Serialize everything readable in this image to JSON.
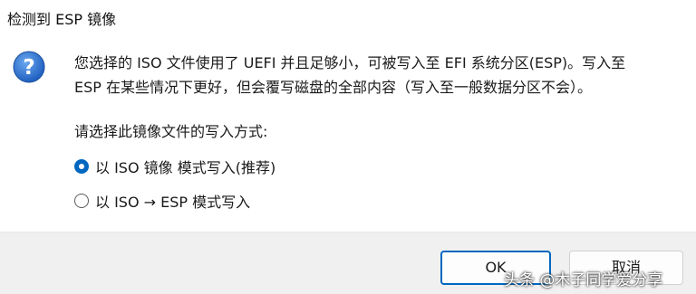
{
  "window": {
    "title": "检测到 ESP 镜像"
  },
  "dialog": {
    "icon": "question-icon",
    "message_line1": "您选择的 ISO 文件使用了 UEFI 并且足够小，可被写入至 EFI 系统分区(ESP)。写入至",
    "message_line2": "ESP 在某些情况下更好，但会覆写磁盘的全部内容（写入至一般数据分区不会）。",
    "question": "请选择此镜像文件的写入方式:",
    "options": [
      {
        "label": "以 ISO 镜像 模式写入(推荐)",
        "selected": true
      },
      {
        "label": "以 ISO → ESP 模式写入",
        "selected": false
      }
    ]
  },
  "buttons": {
    "ok": "OK",
    "cancel": "取消"
  },
  "watermark": "头条 @木子同学爱分享",
  "colors": {
    "accent": "#0067c0",
    "icon_blue": "#2b6fc9",
    "footer_bg": "#f0f0f0"
  }
}
